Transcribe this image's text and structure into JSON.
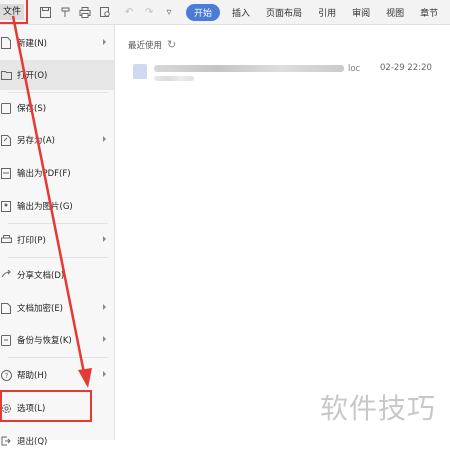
{
  "toolbar": {
    "file_label": "文件",
    "icons": [
      "save-icon",
      "format-painter-icon",
      "print-icon",
      "print-preview-icon",
      "undo-icon",
      "redo-icon",
      "more-icon"
    ],
    "tabs": [
      {
        "label": "开始",
        "active": true
      },
      {
        "label": "插入",
        "active": false
      },
      {
        "label": "页面布局",
        "active": false
      },
      {
        "label": "引用",
        "active": false
      },
      {
        "label": "审阅",
        "active": false
      },
      {
        "label": "视图",
        "active": false
      },
      {
        "label": "章节",
        "active": false
      }
    ],
    "accent_color": "#4a7bd6"
  },
  "menu": {
    "items": [
      {
        "label": "新建(N)",
        "icon": "new-document-icon",
        "submenu": true
      },
      {
        "label": "打开(O)",
        "icon": "open-folder-icon",
        "submenu": false
      },
      {
        "label": "保存(S)",
        "icon": "save-icon",
        "submenu": false
      },
      {
        "label": "另存为(A)",
        "icon": "save-as-icon",
        "submenu": true
      },
      {
        "label": "输出为PDF(F)",
        "icon": "pdf-export-icon",
        "submenu": false
      },
      {
        "label": "输出为图片(G)",
        "icon": "image-export-icon",
        "submenu": false
      },
      {
        "label": "打印(P)",
        "icon": "print-icon",
        "submenu": true
      },
      {
        "label": "分享文档(D)",
        "icon": "share-icon",
        "submenu": false
      },
      {
        "label": "文档加密(E)",
        "icon": "encrypt-icon",
        "submenu": true
      },
      {
        "label": "备份与恢复(K)",
        "icon": "backup-icon",
        "submenu": true
      },
      {
        "label": "帮助(H)",
        "icon": "help-icon",
        "submenu": true
      },
      {
        "label": "选项(L)",
        "icon": "settings-gear-icon",
        "submenu": false
      },
      {
        "label": "退出(Q)",
        "icon": "exit-icon",
        "submenu": false
      }
    ]
  },
  "recent": {
    "title": "最近使用",
    "files": [
      {
        "name_suffix": "loc",
        "time": "02-29 22:20"
      }
    ]
  },
  "annotation": {
    "highlight_color": "#e53935"
  },
  "watermark": "软件技巧"
}
